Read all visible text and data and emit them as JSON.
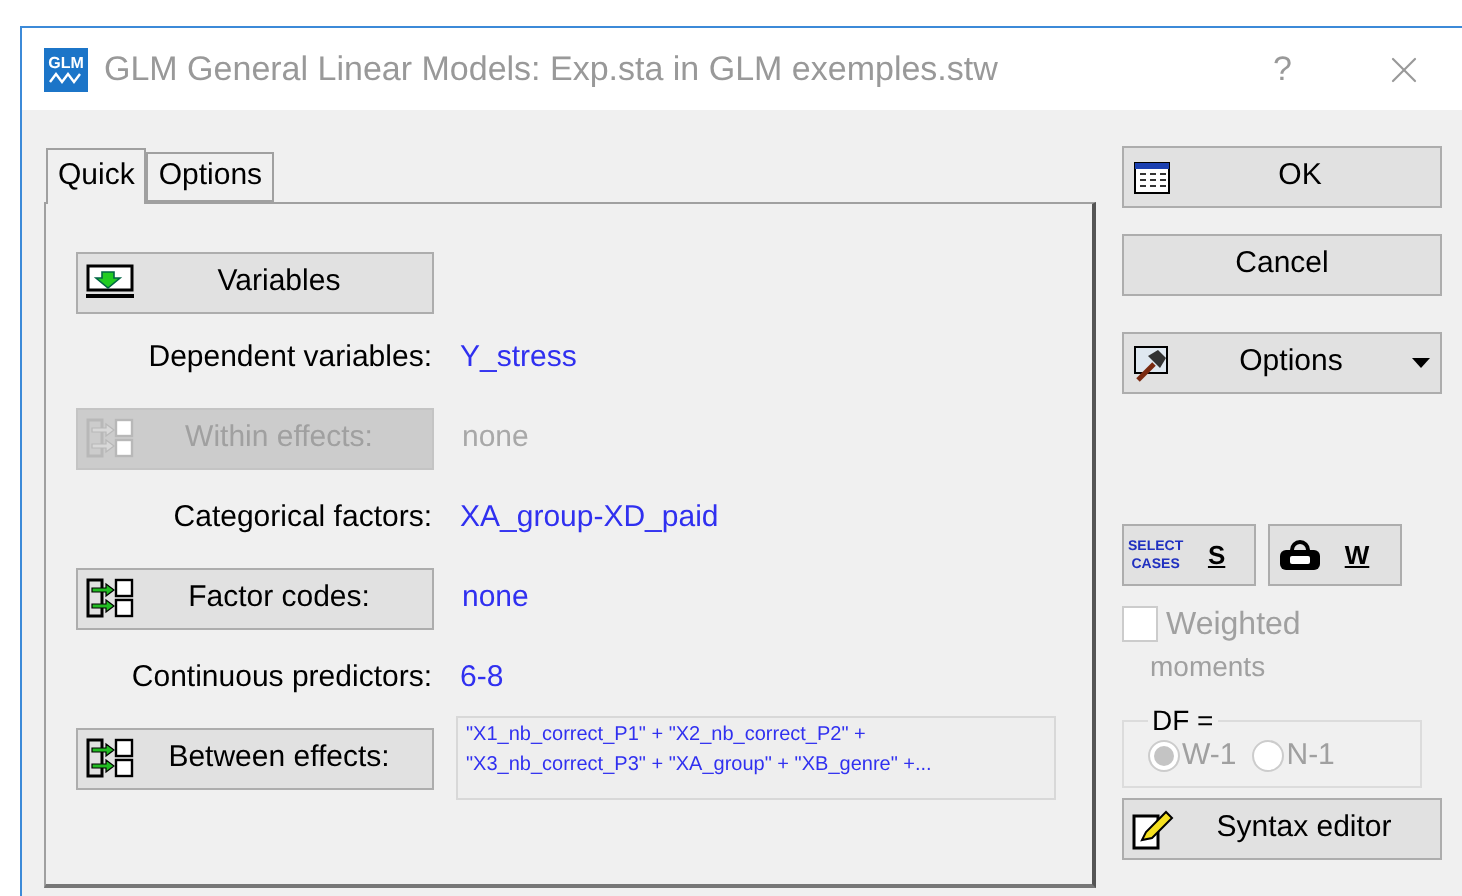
{
  "window": {
    "title": "GLM General Linear Models: Exp.sta in GLM exemples.stw",
    "logo_text": "GLM",
    "help": "?"
  },
  "tabs": [
    {
      "label": "Quick",
      "selected": true
    },
    {
      "label": "Options",
      "selected": false
    }
  ],
  "quick_panel": {
    "rows": [
      {
        "kind": "select_button",
        "label": "Variables",
        "disabled": false
      },
      {
        "kind": "text",
        "label": "Dependent variables:",
        "value": "Y_stress",
        "disabled": false
      },
      {
        "kind": "effects_button",
        "label": "Within effects:",
        "value": "none",
        "disabled": true
      },
      {
        "kind": "text",
        "label": "Categorical factors:",
        "value": "XA_group-XD_paid",
        "disabled": false
      },
      {
        "kind": "effects_button",
        "label": "Factor codes:",
        "value": "none",
        "disabled": false
      },
      {
        "kind": "text",
        "label": "Continuous predictors:",
        "value": "6-8",
        "disabled": false
      },
      {
        "kind": "effects_box",
        "label": "Between effects:",
        "value": "\"X1_nb_correct_P1\" + \"X2_nb_correct_P2\" + \"X3_nb_correct_P3\" + \"XA_group\" + \"XB_genre\" +...",
        "disabled": false
      }
    ]
  },
  "side": {
    "ok": "OK",
    "cancel": "Cancel",
    "options": "Options",
    "select_cases": {
      "icon_lines": [
        "SELECT",
        "CASES"
      ],
      "label": "S"
    },
    "weight": {
      "label": "W"
    },
    "weighted_moments": {
      "label": "Weighted",
      "label_2": "moments",
      "checked": false,
      "disabled": true
    },
    "df": {
      "legend": "DF =",
      "disabled": true,
      "options": [
        {
          "label": "W-1",
          "selected": true
        },
        {
          "label": "N-1",
          "selected": false
        }
      ]
    },
    "syntax": "Syntax editor"
  }
}
